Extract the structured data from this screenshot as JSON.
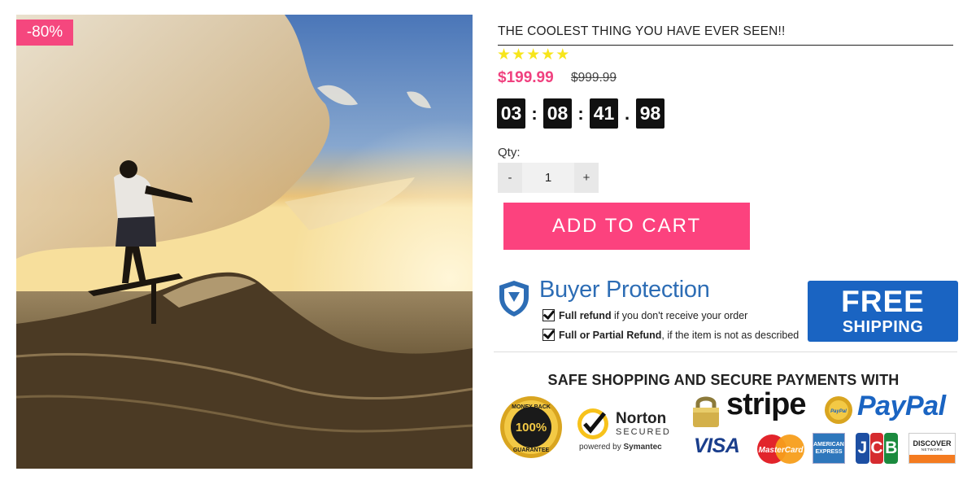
{
  "product": {
    "title": "THE COOLEST THING YOU HAVE EVER SEEN!!",
    "discount_badge": "-80%",
    "rating": 5,
    "price": "$199.99",
    "old_price": "$999.99"
  },
  "countdown": {
    "values": [
      "03",
      "08",
      "41",
      "98"
    ],
    "separators": [
      ":",
      ":",
      "."
    ]
  },
  "quantity": {
    "label": "Qty:",
    "value": "1",
    "decrement": "-",
    "increment": "+"
  },
  "add_to_cart_label": "ADD TO CART",
  "buyer_protection": {
    "title": "Buyer Protection",
    "line1_bold": "Full refund",
    "line1_rest": " if you don't receive your order",
    "line2_bold": "Full or Partial Refund",
    "line2_rest": ", if the item is not as described"
  },
  "free_shipping": {
    "big": "FREE",
    "small": "SHIPPING"
  },
  "secure": {
    "heading": "SAFE SHOPPING AND SECURE PAYMENTS WITH"
  },
  "badges": {
    "money_back_top": "MONEY BACK",
    "money_back_pct": "100%",
    "money_back_bottom": "GUARANTEE",
    "norton_word": "Norton",
    "norton_secured": "SECURED",
    "norton_powered_prefix": "powered by ",
    "norton_powered_brand": "Symantec",
    "stripe": "stripe",
    "paypal": "PayPal",
    "paypal_seal": "PayPal",
    "visa": "VISA",
    "mastercard": "MasterCard",
    "amex_line1": "AMERICAN",
    "amex_line2": "EXPRESS",
    "jcb": [
      "J",
      "C",
      "B"
    ],
    "discover": "DISCOVER",
    "discover_sub": "NETWORK"
  },
  "colors": {
    "accent_pink": "#fc427e",
    "price_pink": "#f0417f",
    "star_yellow": "#f7e51b",
    "brand_blue": "#1a64c2",
    "jcb_blue": "#1d4fa3",
    "jcb_red": "#d52b2f",
    "jcb_green": "#1b8a3e"
  }
}
